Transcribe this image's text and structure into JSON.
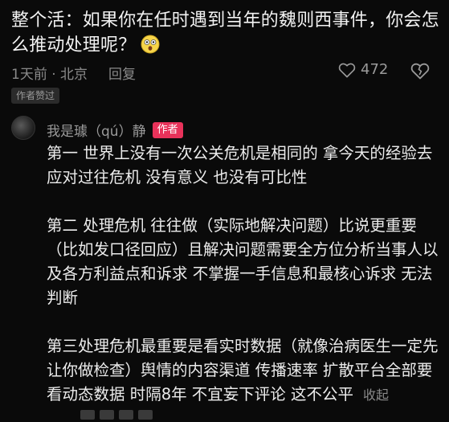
{
  "question": {
    "text": "整个活：如果你在任时遇到当年的魏则西事件，你会怎么推动处理呢？",
    "emoji_icon": "surprised-face-icon"
  },
  "meta": {
    "time": "1天前 · 北京",
    "reply_label": "回复",
    "like_count": "472"
  },
  "author_liked_label": "作者赞过",
  "reply": {
    "username": "我是璩（qú）静",
    "author_badge": "作者",
    "paragraphs": [
      "第一 世界上没有一次公关危机是相同的 拿今天的经验去应对过往危机 没有意义 也没有可比性",
      "第二  处理危机 往往做（实际地解决问题）比说更重要（比如发口径回应）且解决问题需要全方位分析当事人以及各方利益点和诉求 不掌握一手信息和最核心诉求 无法判断",
      "第三处理危机最重要是看实时数据（就像治病医生一定先让你做检查）舆情的内容渠道 传播速率 扩散平台全部要看动态数据  时隔8年 不宜妄下评论 这不公平"
    ],
    "collapse_label": "收起"
  },
  "colors": {
    "background": "#0a0a0a",
    "author_badge": "#e8325a",
    "muted_text": "#8a8a8a"
  }
}
